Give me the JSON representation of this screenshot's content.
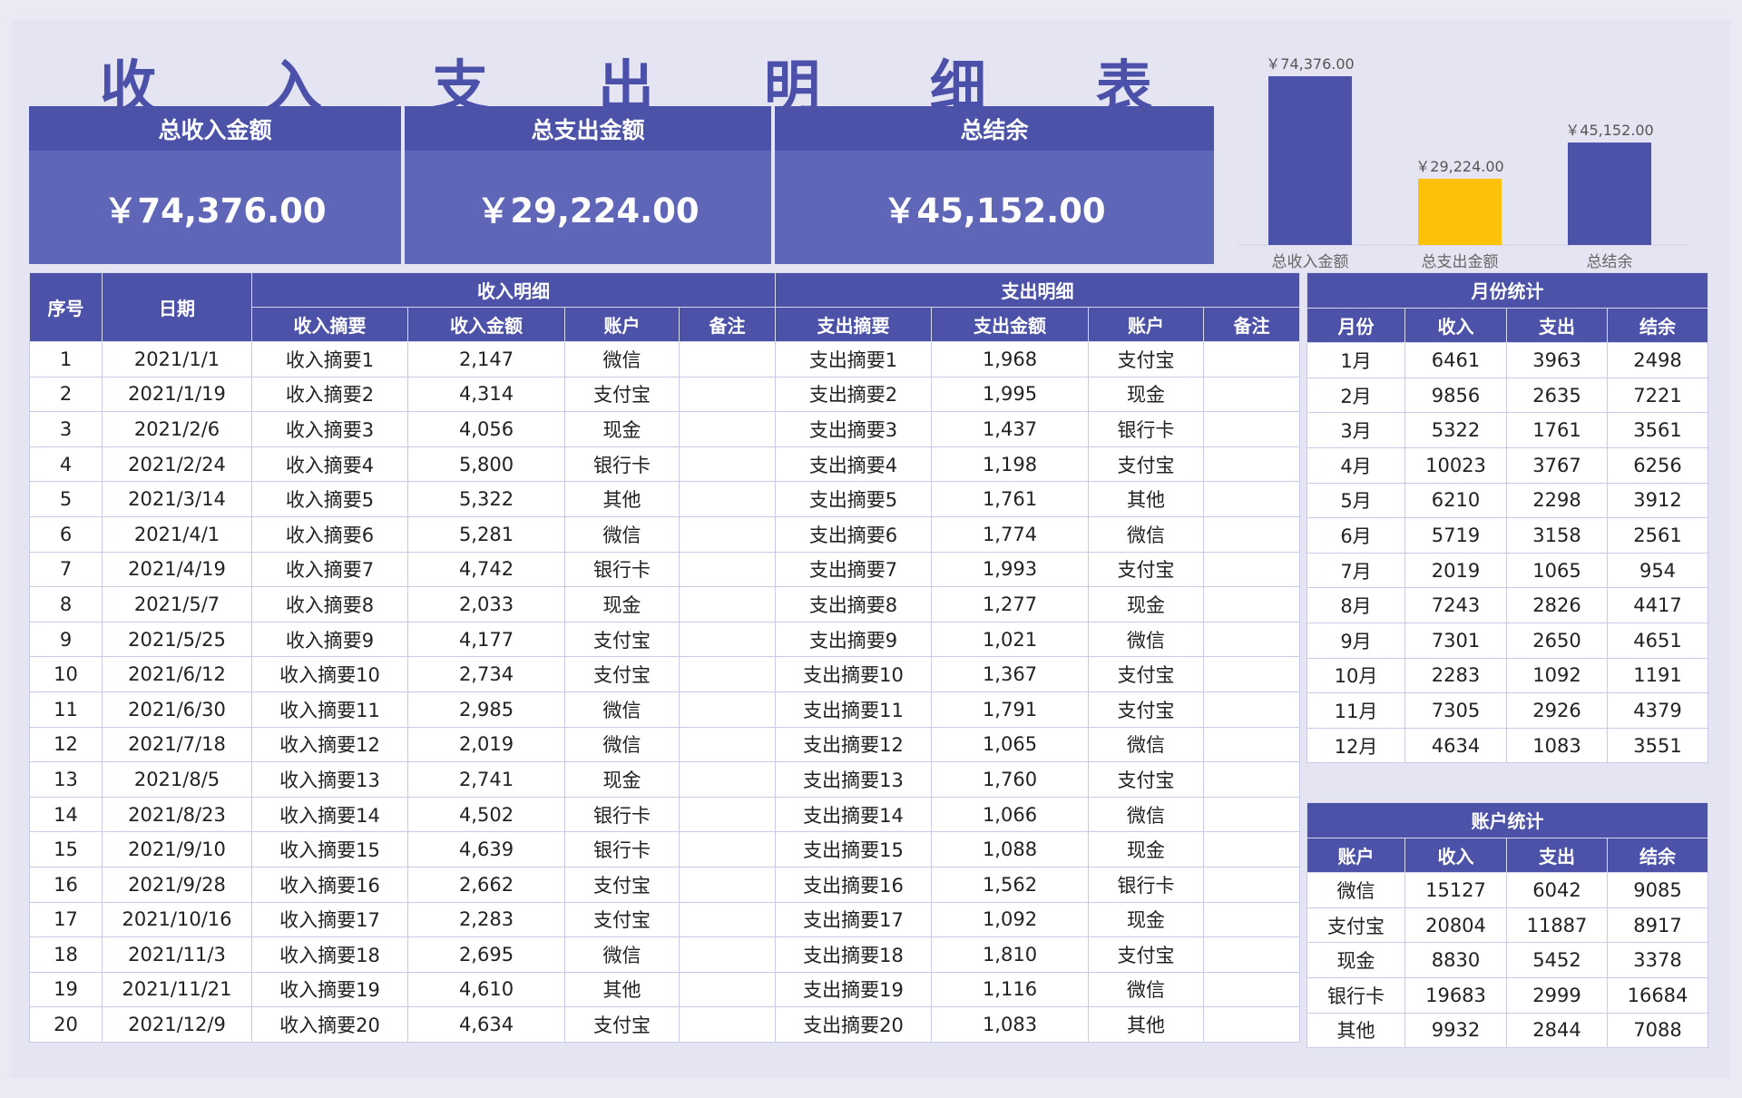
{
  "title_chars": [
    "收",
    "入",
    "支",
    "出",
    "明",
    "细",
    "表"
  ],
  "summary": [
    {
      "label": "总收入金额",
      "value": "￥74,376.00"
    },
    {
      "label": "总支出金额",
      "value": "￥29,224.00"
    },
    {
      "label": "总结余",
      "value": "￥45,152.00"
    }
  ],
  "colors": {
    "primary": "#4b52a8",
    "card": "#5f66b7",
    "accent": "#fcc20a"
  },
  "chart_data": {
    "type": "bar",
    "categories": [
      "总收入金额",
      "总支出金额",
      "总结余"
    ],
    "values": [
      74376,
      29224,
      45152
    ],
    "data_labels": [
      "￥74,376.00",
      "￥29,224.00",
      "￥45,152.00"
    ],
    "bar_colors": [
      "#4b52a8",
      "#fcc20a",
      "#4b52a8"
    ],
    "ylim": [
      0,
      80000
    ],
    "grid": false,
    "title": ""
  },
  "main_table": {
    "col_seq": "序号",
    "col_date": "日期",
    "group_income": "收入明细",
    "group_expense": "支出明细",
    "income_headers": [
      "收入摘要",
      "收入金额",
      "账户",
      "备注"
    ],
    "expense_headers": [
      "支出摘要",
      "支出金额",
      "账户",
      "备注"
    ],
    "rows": [
      [
        "1",
        "2021/1/1",
        "收入摘要1",
        "2,147",
        "微信",
        "",
        "支出摘要1",
        "1,968",
        "支付宝",
        ""
      ],
      [
        "2",
        "2021/1/19",
        "收入摘要2",
        "4,314",
        "支付宝",
        "",
        "支出摘要2",
        "1,995",
        "现金",
        ""
      ],
      [
        "3",
        "2021/2/6",
        "收入摘要3",
        "4,056",
        "现金",
        "",
        "支出摘要3",
        "1,437",
        "银行卡",
        ""
      ],
      [
        "4",
        "2021/2/24",
        "收入摘要4",
        "5,800",
        "银行卡",
        "",
        "支出摘要4",
        "1,198",
        "支付宝",
        ""
      ],
      [
        "5",
        "2021/3/14",
        "收入摘要5",
        "5,322",
        "其他",
        "",
        "支出摘要5",
        "1,761",
        "其他",
        ""
      ],
      [
        "6",
        "2021/4/1",
        "收入摘要6",
        "5,281",
        "微信",
        "",
        "支出摘要6",
        "1,774",
        "微信",
        ""
      ],
      [
        "7",
        "2021/4/19",
        "收入摘要7",
        "4,742",
        "银行卡",
        "",
        "支出摘要7",
        "1,993",
        "支付宝",
        ""
      ],
      [
        "8",
        "2021/5/7",
        "收入摘要8",
        "2,033",
        "现金",
        "",
        "支出摘要8",
        "1,277",
        "现金",
        ""
      ],
      [
        "9",
        "2021/5/25",
        "收入摘要9",
        "4,177",
        "支付宝",
        "",
        "支出摘要9",
        "1,021",
        "微信",
        ""
      ],
      [
        "10",
        "2021/6/12",
        "收入摘要10",
        "2,734",
        "支付宝",
        "",
        "支出摘要10",
        "1,367",
        "支付宝",
        ""
      ],
      [
        "11",
        "2021/6/30",
        "收入摘要11",
        "2,985",
        "微信",
        "",
        "支出摘要11",
        "1,791",
        "支付宝",
        ""
      ],
      [
        "12",
        "2021/7/18",
        "收入摘要12",
        "2,019",
        "微信",
        "",
        "支出摘要12",
        "1,065",
        "微信",
        ""
      ],
      [
        "13",
        "2021/8/5",
        "收入摘要13",
        "2,741",
        "现金",
        "",
        "支出摘要13",
        "1,760",
        "支付宝",
        ""
      ],
      [
        "14",
        "2021/8/23",
        "收入摘要14",
        "4,502",
        "银行卡",
        "",
        "支出摘要14",
        "1,066",
        "微信",
        ""
      ],
      [
        "15",
        "2021/9/10",
        "收入摘要15",
        "4,639",
        "银行卡",
        "",
        "支出摘要15",
        "1,088",
        "现金",
        ""
      ],
      [
        "16",
        "2021/9/28",
        "收入摘要16",
        "2,662",
        "支付宝",
        "",
        "支出摘要16",
        "1,562",
        "银行卡",
        ""
      ],
      [
        "17",
        "2021/10/16",
        "收入摘要17",
        "2,283",
        "支付宝",
        "",
        "支出摘要17",
        "1,092",
        "现金",
        ""
      ],
      [
        "18",
        "2021/11/3",
        "收入摘要18",
        "2,695",
        "微信",
        "",
        "支出摘要18",
        "1,810",
        "支付宝",
        ""
      ],
      [
        "19",
        "2021/11/21",
        "收入摘要19",
        "4,610",
        "其他",
        "",
        "支出摘要19",
        "1,116",
        "微信",
        ""
      ],
      [
        "20",
        "2021/12/9",
        "收入摘要20",
        "4,634",
        "支付宝",
        "",
        "支出摘要20",
        "1,083",
        "其他",
        ""
      ]
    ]
  },
  "monthly": {
    "title": "月份统计",
    "headers": [
      "月份",
      "收入",
      "支出",
      "结余"
    ],
    "rows": [
      [
        "1月",
        "6461",
        "3963",
        "2498"
      ],
      [
        "2月",
        "9856",
        "2635",
        "7221"
      ],
      [
        "3月",
        "5322",
        "1761",
        "3561"
      ],
      [
        "4月",
        "10023",
        "3767",
        "6256"
      ],
      [
        "5月",
        "6210",
        "2298",
        "3912"
      ],
      [
        "6月",
        "5719",
        "3158",
        "2561"
      ],
      [
        "7月",
        "2019",
        "1065",
        "954"
      ],
      [
        "8月",
        "7243",
        "2826",
        "4417"
      ],
      [
        "9月",
        "7301",
        "2650",
        "4651"
      ],
      [
        "10月",
        "2283",
        "1092",
        "1191"
      ],
      [
        "11月",
        "7305",
        "2926",
        "4379"
      ],
      [
        "12月",
        "4634",
        "1083",
        "3551"
      ]
    ]
  },
  "accounts": {
    "title": "账户统计",
    "headers": [
      "账户",
      "收入",
      "支出",
      "结余"
    ],
    "rows": [
      [
        "微信",
        "15127",
        "6042",
        "9085"
      ],
      [
        "支付宝",
        "20804",
        "11887",
        "8917"
      ],
      [
        "现金",
        "8830",
        "5452",
        "3378"
      ],
      [
        "银行卡",
        "19683",
        "2999",
        "16684"
      ],
      [
        "其他",
        "9932",
        "2844",
        "7088"
      ]
    ]
  }
}
